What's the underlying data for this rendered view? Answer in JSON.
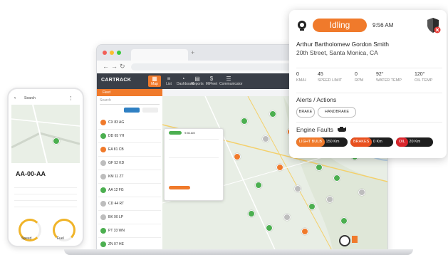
{
  "popup": {
    "status": "Idling",
    "time": "9:56 AM",
    "driver": "Arthur Bartholomew Gordon Smith",
    "address": "20th Street, Santa Monica, CA",
    "stats": [
      {
        "value": "0",
        "label": "KM/H"
      },
      {
        "value": "45",
        "label": "SPEED LIMIT"
      },
      {
        "value": "0",
        "label": "RPM"
      },
      {
        "value": "92°",
        "label": "WATER TEMP"
      },
      {
        "value": "120°",
        "label": "OIL TEMP"
      }
    ],
    "alerts_title": "Alerts / Actions",
    "alerts": [
      "BRAKE",
      "HANDBRAKE"
    ],
    "faults_title": "Engine Faults",
    "faults": [
      {
        "label": "LIGHT BULB",
        "value": "150 Km",
        "color": "#f07a2b"
      },
      {
        "label": "BRAKES",
        "value": "0 Km",
        "color": "#e8501e"
      },
      {
        "label": "OIL",
        "value": "20 Km",
        "color": "#d8252b"
      }
    ],
    "accent": "#f07a2b"
  },
  "laptop": {
    "brand": "CARTRACK",
    "nav": [
      "Map",
      "List",
      "Dashboard",
      "Reports",
      "MiFleet",
      "Communicator"
    ],
    "fleet_label": "Fleet",
    "search_placeholder": "Search",
    "vehicles": [
      "CX 83 AG",
      "DD 65 YH",
      "EA 81 CB",
      "GF 52 KD",
      "KM 11 ZT",
      "AA 12 FG",
      "CD 44 RT",
      "BK 90 LP",
      "PT 33 WN",
      "ZN 07 HE"
    ],
    "vehicle_colors": [
      "#f07a2b",
      "#4caf50",
      "#f07a2b",
      "#bdbdbd",
      "#bdbdbd",
      "#4caf50",
      "#bdbdbd",
      "#bdbdbd",
      "#4caf50",
      "#4caf50"
    ],
    "mini_popup": {
      "status": "Idling",
      "time": "9:56 AM"
    }
  },
  "phone": {
    "search": "Search",
    "plate": "AA-00-AA",
    "speed_label": "Speed",
    "fuel_label": "Fuel"
  }
}
